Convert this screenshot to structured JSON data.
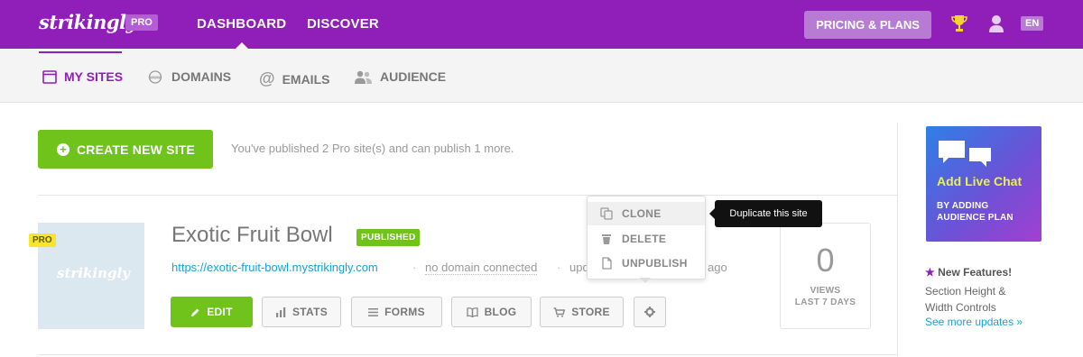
{
  "header": {
    "logo": "strikingly",
    "plan_badge": "PRO",
    "nav": [
      "DASHBOARD",
      "DISCOVER"
    ],
    "pricing_button": "PRICING & PLANS",
    "language": "EN"
  },
  "subnav": {
    "items": [
      {
        "label": "MY SITES",
        "icon": "browser-window-icon"
      },
      {
        "label": "DOMAINS",
        "icon": "www-icon"
      },
      {
        "label": "EMAILS",
        "icon": "at-sign-icon"
      },
      {
        "label": "AUDIENCE",
        "icon": "people-icon"
      }
    ]
  },
  "main": {
    "create_button": "CREATE NEW SITE",
    "publish_note": "You've published 2 Pro site(s) and can publish 1 more."
  },
  "site": {
    "pro_ribbon": "PRO",
    "thumb_logo": "strikingly",
    "title": "Exotic Fruit Bowl",
    "status": "PUBLISHED",
    "url": "https://exotic-fruit-bowl.mystrikingly.com",
    "separator": "·",
    "domain_status": "no domain connected",
    "updated_text": "upd",
    "updated_suffix": "ago",
    "buttons": {
      "edit": "EDIT",
      "stats": "STATS",
      "forms": "FORMS",
      "blog": "BLOG",
      "store": "STORE"
    },
    "views_count": "0",
    "views_label_line1": "VIEWS",
    "views_label_line2": "LAST 7 DAYS"
  },
  "settings_menu": {
    "items": [
      "CLONE",
      "DELETE",
      "UNPUBLISH"
    ],
    "tooltip": "Duplicate this site"
  },
  "sidebar": {
    "promo_title": "Add Live Chat",
    "promo_sub_line1": "BY ADDING",
    "promo_sub_line2": "AUDIENCE PLAN",
    "new_features_title": "New Features!",
    "new_features_line1": "Section Height &",
    "new_features_line2": "Width Controls",
    "more_link": "See more updates »"
  },
  "colors": {
    "brand_purple": "#8f1fb8",
    "green": "#6fc31a",
    "link_blue": "#1a9fd6"
  }
}
